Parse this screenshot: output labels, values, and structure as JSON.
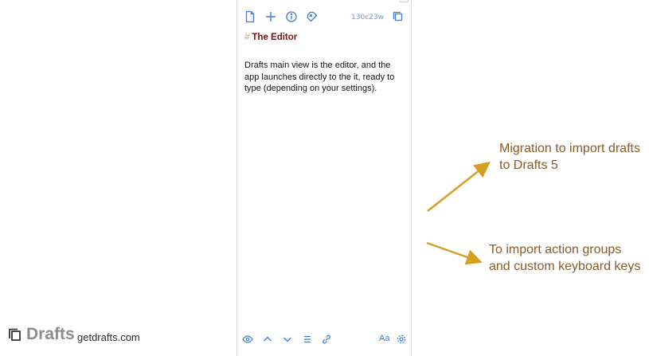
{
  "editor": {
    "counter": "130c23w",
    "heading_mark": "#",
    "heading": "The Editor",
    "body": "Drafts main view is the editor, and the app launches directly to the it, ready to type (depending on your settings)."
  },
  "bottom_toolbar": {
    "font_button": "Aa"
  },
  "annotations": {
    "top": "Migration to import drafts to Drafts 5",
    "bottom": "To import action groups and custom keyboard keys"
  },
  "branding": {
    "name": "Drafts",
    "url": "getdrafts.com"
  },
  "colors": {
    "accent": "#3a7bd5",
    "heading": "#7a1111",
    "annotation": "#8a5a25",
    "arrow": "#d4a020"
  }
}
